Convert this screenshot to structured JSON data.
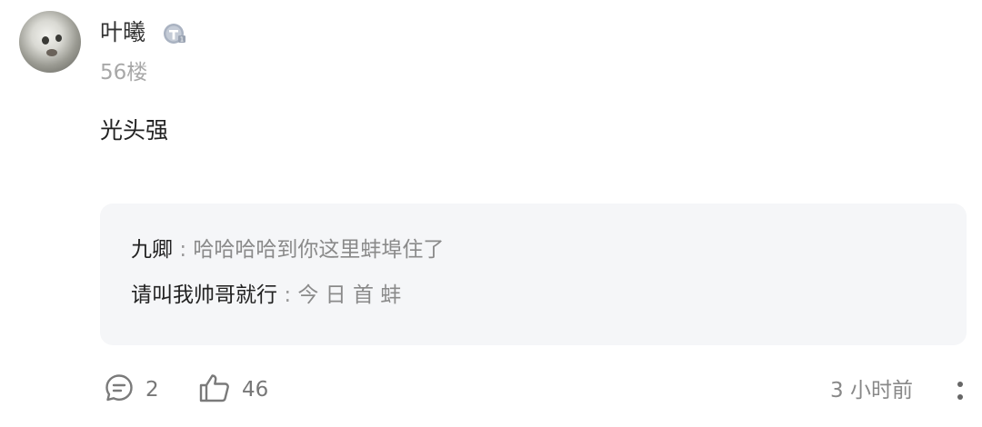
{
  "comment": {
    "username": "叶曦",
    "badge_icon": "level-badge-icon",
    "floor": "56楼",
    "text": "光头强"
  },
  "replies": [
    {
      "name": "九卿",
      "separator": ":",
      "text": "哈哈哈哈到你这里蚌埠住了"
    },
    {
      "name": "请叫我帅哥就行",
      "separator": ":",
      "text": "今 日 首 蚌"
    }
  ],
  "footer": {
    "reply_count": "2",
    "like_count": "46",
    "time": "3 小时前"
  },
  "colors": {
    "reply_bg": "#f5f6f8",
    "muted_text": "#a8a8a8",
    "icon_gray": "#7a7a7a"
  }
}
